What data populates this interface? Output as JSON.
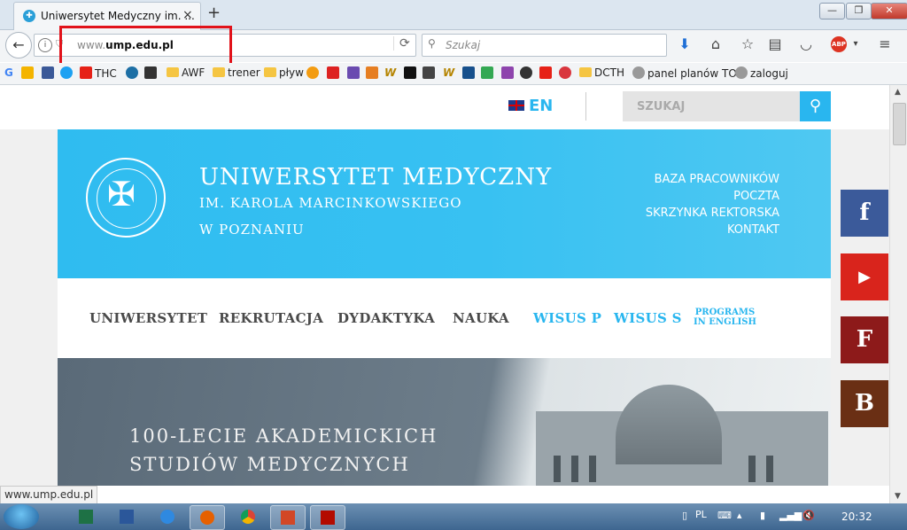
{
  "browser": {
    "tab_title": "Uniwersytet Medyczny im. ...",
    "new_tab": "+",
    "close_tab": "×",
    "url_prefix": "www.",
    "url_domain": "ump.edu.pl",
    "search_placeholder": "Szukaj",
    "status_url": "www.ump.edu.pl",
    "window_controls": {
      "minimize": "—",
      "maximize": "❐",
      "close": "✕"
    },
    "toolbar_icons": [
      "download-icon",
      "home-icon",
      "star-icon",
      "reading-list-icon",
      "pocket-icon",
      "adblock-icon",
      "menu-icon"
    ],
    "highlight_color": "#e1121a"
  },
  "bookmarks": [
    {
      "label": "THC"
    },
    {
      "label": "AWF"
    },
    {
      "label": "trener"
    },
    {
      "label": "pływ"
    },
    {
      "label": "DCTH"
    },
    {
      "label": "panel planów TO"
    },
    {
      "label": "zaloguj"
    }
  ],
  "site": {
    "lang": "EN",
    "search_label": "SZUKAJ",
    "name_line1": "UNIWERSYTET MEDYCZNY",
    "name_line2": "IM. KAROLA MARCINKOWSKIEGO",
    "name_line3": "W POZNANIU",
    "top_links": [
      "BAZA PRACOWNIKÓW",
      "POCZTA",
      "SKRZYNKA REKTORSKA",
      "KONTAKT"
    ],
    "menu": [
      "UNIWERSYTET",
      "REKRUTACJA",
      "DYDAKTYKA",
      "NAUKA",
      "WISUS P",
      "WISUS S"
    ],
    "programs_line1": "PROGRAMS",
    "programs_line2": "IN ENGLISH",
    "banner_line1": "100-LECIE AKADEMICKICH",
    "banner_line2": "STUDIÓW MEDYCZNYCH",
    "social": [
      {
        "letter": "f",
        "color": "#3b5a9a"
      },
      {
        "letter": "▶",
        "color": "#d9241c"
      },
      {
        "letter": "F",
        "color": "#8d1a1a"
      },
      {
        "letter": "B",
        "color": "#6a2f14"
      }
    ],
    "accent_color": "#29b6ef"
  },
  "taskbar": {
    "lang": "PL",
    "clock": "20:32"
  }
}
